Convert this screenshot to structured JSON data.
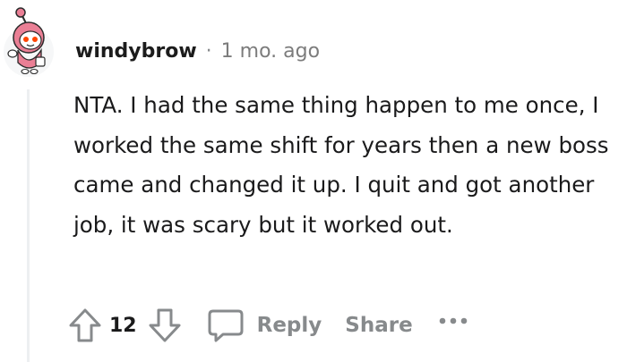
{
  "comment": {
    "author": "windybrow",
    "separator": "·",
    "timestamp": "1 mo. ago",
    "body": "NTA. I had the same thing happen to me once, I worked the same shift for years then a new boss came and changed it up. I quit and got another job, it was scary but it worked out."
  },
  "actions": {
    "upvote_icon": "upvote-arrow-icon",
    "vote_count": "12",
    "downvote_icon": "downvote-arrow-icon",
    "reply_icon": "comment-bubble-icon",
    "reply_label": "Reply",
    "share_label": "Share",
    "more_icon": "more-dots-icon"
  },
  "colors": {
    "meta_gray": "#878a8c",
    "text": "#1a1a1b",
    "thread_line": "#edeff1",
    "avatar_bg": "#f6f7f8",
    "avatar_pink": "#ea7f95"
  }
}
